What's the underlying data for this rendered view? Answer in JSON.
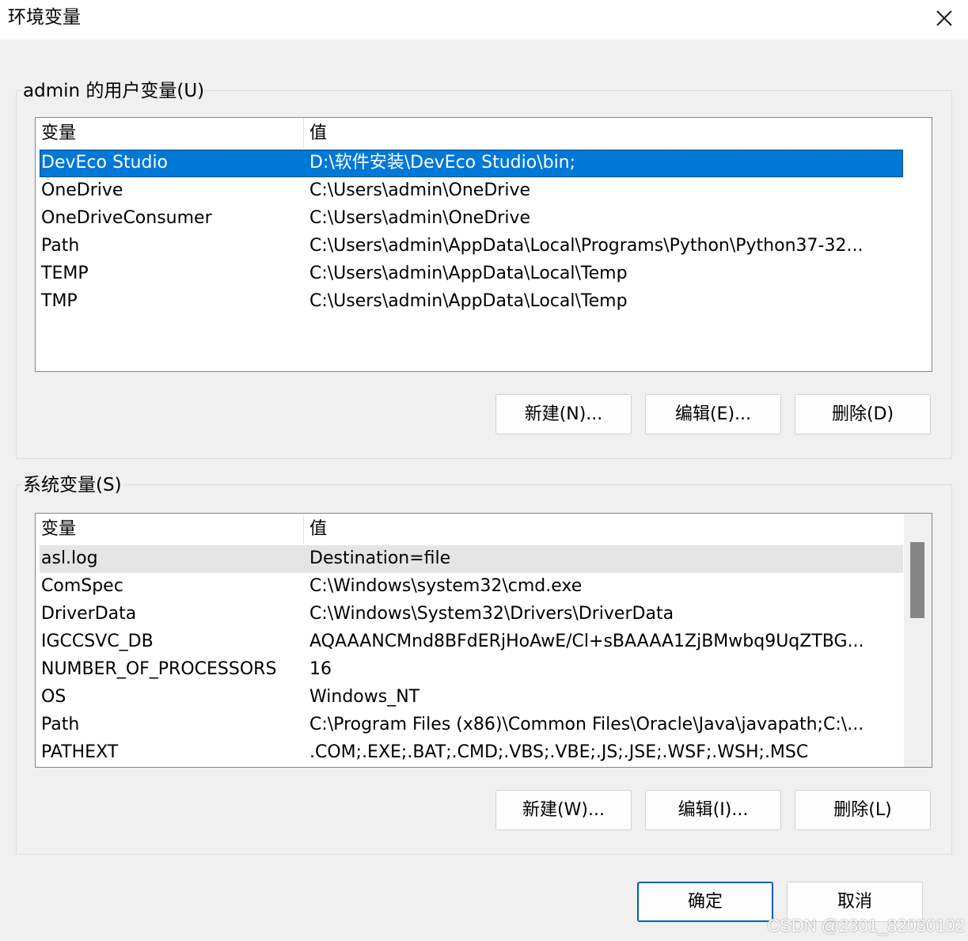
{
  "window": {
    "title": "环境变量"
  },
  "user_group": {
    "title": "admin 的用户变量(U)",
    "columns": [
      "变量",
      "值"
    ],
    "rows": [
      {
        "name": "DevEco Studio",
        "value": "D:\\软件安装\\DevEco Studio\\bin;",
        "selected": true
      },
      {
        "name": "OneDrive",
        "value": "C:\\Users\\admin\\OneDrive"
      },
      {
        "name": "OneDriveConsumer",
        "value": "C:\\Users\\admin\\OneDrive"
      },
      {
        "name": "Path",
        "value": "C:\\Users\\admin\\AppData\\Local\\Programs\\Python\\Python37-32..."
      },
      {
        "name": "TEMP",
        "value": "C:\\Users\\admin\\AppData\\Local\\Temp"
      },
      {
        "name": "TMP",
        "value": "C:\\Users\\admin\\AppData\\Local\\Temp"
      }
    ],
    "buttons": {
      "new": "新建(N)...",
      "edit": "编辑(E)...",
      "delete": "删除(D)"
    }
  },
  "system_group": {
    "title": "系统变量(S)",
    "columns": [
      "变量",
      "值"
    ],
    "rows": [
      {
        "name": "asl.log",
        "value": "Destination=file",
        "hover": true
      },
      {
        "name": "ComSpec",
        "value": "C:\\Windows\\system32\\cmd.exe"
      },
      {
        "name": "DriverData",
        "value": "C:\\Windows\\System32\\Drivers\\DriverData"
      },
      {
        "name": "IGCCSVC_DB",
        "value": "AQAAANCMnd8BFdERjHoAwE/Cl+sBAAAA1ZjBMwbq9UqZTBG..."
      },
      {
        "name": "NUMBER_OF_PROCESSORS",
        "value": "16"
      },
      {
        "name": "OS",
        "value": "Windows_NT"
      },
      {
        "name": "Path",
        "value": "C:\\Program Files (x86)\\Common Files\\Oracle\\Java\\javapath;C:\\..."
      },
      {
        "name": "PATHEXT",
        "value": ".COM;.EXE;.BAT;.CMD;.VBS;.VBE;.JS;.JSE;.WSF;.WSH;.MSC"
      }
    ],
    "buttons": {
      "new": "新建(W)...",
      "edit": "编辑(I)...",
      "delete": "删除(L)"
    }
  },
  "footer": {
    "ok": "确定",
    "cancel": "取消"
  },
  "watermark": "CSDN @2301_82030102",
  "colors": {
    "selection": "#0078d7",
    "hover": "#e5e5e5",
    "primary_border": "#005fb8"
  }
}
